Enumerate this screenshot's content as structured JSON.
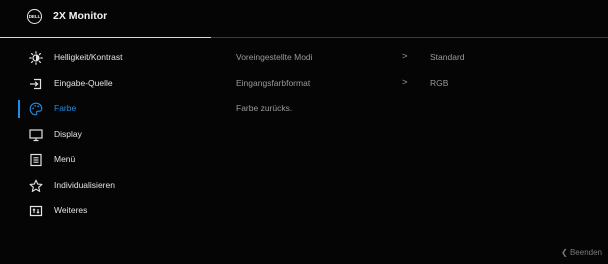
{
  "header": {
    "logo_text": "DELL",
    "title": "2X Monitor"
  },
  "menu": {
    "items": [
      {
        "label": "Helligkeit/Kontrast",
        "icon": "brightness-icon"
      },
      {
        "label": "Eingabe-Quelle",
        "icon": "input-source-icon"
      },
      {
        "label": "Farbe",
        "icon": "color-palette-icon",
        "active": true
      },
      {
        "label": "Display",
        "icon": "display-monitor-icon"
      },
      {
        "label": "Menü",
        "icon": "menu-list-icon"
      },
      {
        "label": "Individualisieren",
        "icon": "star-icon"
      },
      {
        "label": "Weiteres",
        "icon": "others-icon"
      }
    ]
  },
  "submenu": {
    "items": [
      {
        "label": "Voreingestellte Modi",
        "chevron": ">",
        "value": "Standard"
      },
      {
        "label": "Eingangsfarbformat",
        "chevron": ">",
        "value": "RGB"
      },
      {
        "label": "Farbe zurücks.",
        "chevron": "",
        "value": ""
      }
    ]
  },
  "footer": {
    "exit_label": "❮ Beenden"
  },
  "colors": {
    "accent": "#1e8ee6",
    "background": "#050505",
    "text": "#e3e3e3",
    "muted": "#9a9a9a"
  }
}
